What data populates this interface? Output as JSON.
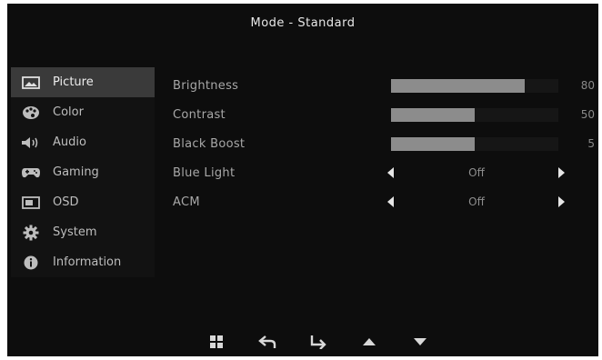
{
  "header": {
    "title": "Mode  -  Standard"
  },
  "sidebar": {
    "items": [
      {
        "label": "Picture",
        "icon": "picture-icon",
        "active": true
      },
      {
        "label": "Color",
        "icon": "palette-icon",
        "active": false
      },
      {
        "label": "Audio",
        "icon": "speaker-icon",
        "active": false
      },
      {
        "label": "Gaming",
        "icon": "gamepad-icon",
        "active": false
      },
      {
        "label": "OSD",
        "icon": "osd-icon",
        "active": false
      },
      {
        "label": "System",
        "icon": "gear-icon",
        "active": false
      },
      {
        "label": "Information",
        "icon": "info-icon",
        "active": false
      }
    ]
  },
  "settings": {
    "brightness": {
      "label": "Brightness",
      "value": "80",
      "level_percent": 80
    },
    "contrast": {
      "label": "Contrast",
      "value": "50",
      "level_percent": 50
    },
    "black_boost": {
      "label": "Black  Boost",
      "value": "5",
      "level_percent": 50
    },
    "blue_light": {
      "label": "Blue  Light",
      "value": "Off"
    },
    "acm": {
      "label": "ACM",
      "value": "Off"
    }
  },
  "footer": {
    "keys": [
      "menu-grid-icon",
      "back-icon",
      "enter-icon",
      "up-arrow-icon",
      "down-arrow-icon"
    ]
  },
  "colors": {
    "background": "#0d0d0d",
    "active_item": "#3a3a3a",
    "bar_fill": "#8c8c8c"
  }
}
